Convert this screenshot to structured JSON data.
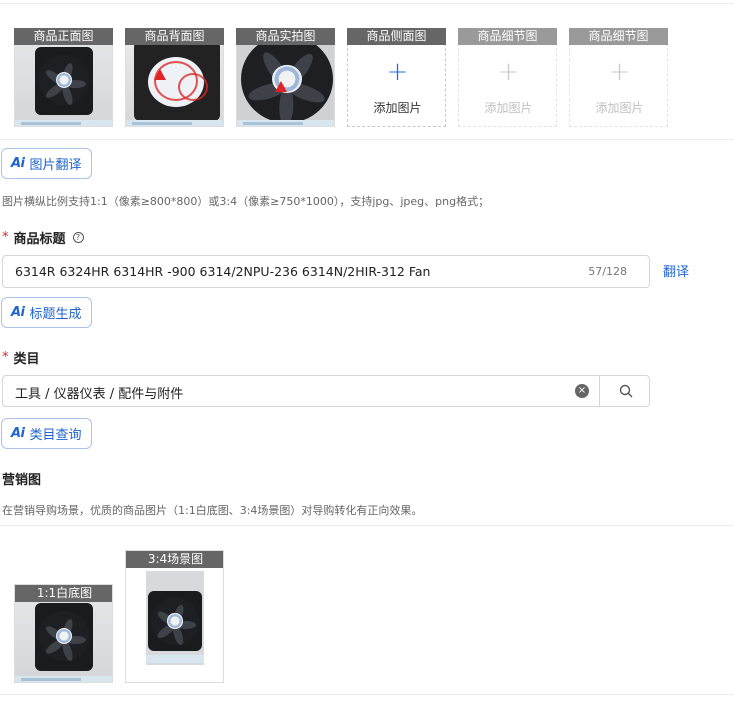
{
  "images": {
    "slots": [
      {
        "label": "商品正面图",
        "state": "filled"
      },
      {
        "label": "商品背面图",
        "state": "filled"
      },
      {
        "label": "商品实拍图",
        "state": "filled"
      },
      {
        "label": "商品侧面图",
        "state": "empty",
        "add_text": "添加图片"
      },
      {
        "label": "商品细节图",
        "state": "disabled",
        "add_text": "添加图片"
      },
      {
        "label": "商品细节图",
        "state": "disabled",
        "add_text": "添加图片"
      }
    ],
    "translate_button": "图片翻译",
    "hint": "图片横纵比例支持1:1（像素≥800*800）或3:4（像素≥750*1000），支持jpg、jpeg、png格式；"
  },
  "title_field": {
    "label": "商品标题",
    "help_icon": "?",
    "value": "6314R 6324HR 6314HR -900 6314/2NPU-236 6314N/2HIR-312 Fan",
    "counter": "57/128",
    "translate_link": "翻译",
    "generate_button": "标题生成"
  },
  "category_field": {
    "label": "类目",
    "value": "工具 / 仪器仪表 / 配件与附件",
    "query_button": "类目查询"
  },
  "marketing": {
    "label": "营销图",
    "hint": "在营销导购场景，优质的商品图片（1:1白底图、3:4场景图）对导购转化有正向效果。",
    "slots": [
      {
        "label": "1:1白底图"
      },
      {
        "label": "3:4场景图"
      }
    ]
  },
  "icons": {
    "ai": "Ai",
    "clear": "×",
    "plus": "+"
  },
  "colors": {
    "accent": "#1e63d0",
    "required": "#e02424",
    "label_bg": "#666666"
  }
}
